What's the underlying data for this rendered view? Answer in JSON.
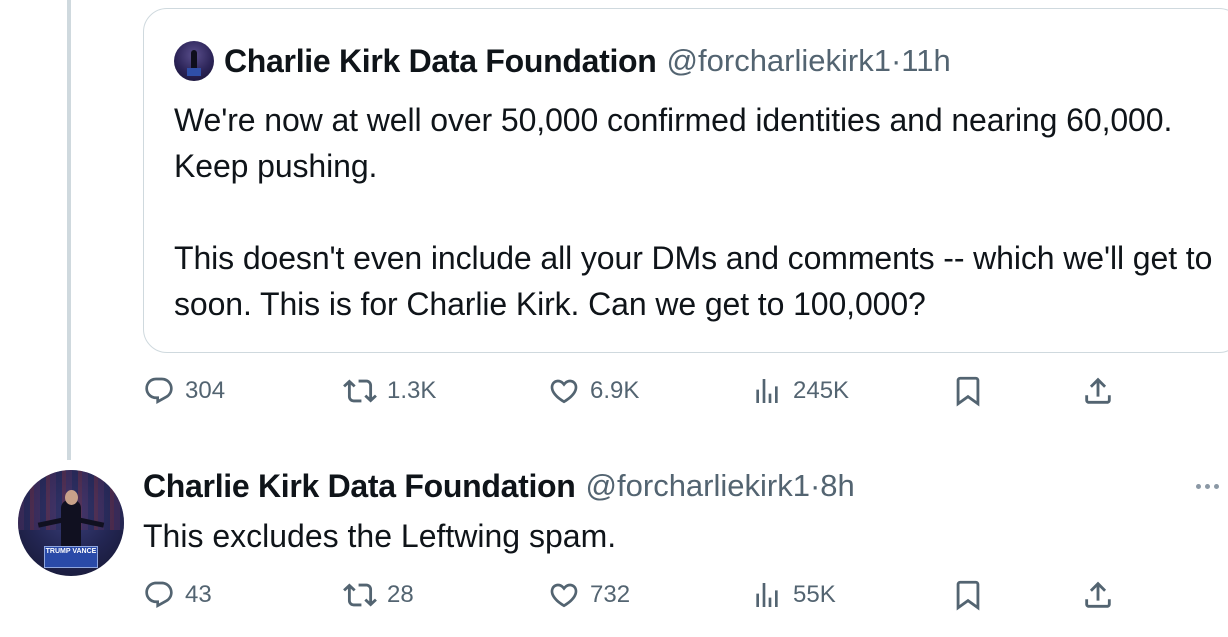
{
  "quote": {
    "author_name": "Charlie Kirk Data Foundation",
    "handle": "@forcharliekirk1",
    "separator": "·",
    "time": "11h",
    "text": "We're now at well over 50,000 confirmed identities and nearing 60,000. Keep pushing.\n\nThis doesn't even include all your DMs and comments -- which we'll get to soon. This is for Charlie Kirk. Can we get to 100,000?"
  },
  "quote_actions": {
    "replies": "304",
    "reposts": "1.3K",
    "likes": "6.9K",
    "views": "245K"
  },
  "reply": {
    "author_name": "Charlie Kirk Data Foundation",
    "handle": "@forcharliekirk1",
    "separator": "·",
    "time": "8h",
    "text": "This excludes the Leftwing spam.",
    "avatar_podium_text": "TRUMP VANCE"
  },
  "reply_actions": {
    "replies": "43",
    "reposts": "28",
    "likes": "732",
    "views": "55K"
  },
  "icons": [
    "reply-icon",
    "repost-icon",
    "like-icon",
    "views-icon",
    "bookmark-icon",
    "share-icon",
    "more-icon"
  ],
  "colors": {
    "text": "#0f1419",
    "secondary": "#536471",
    "border": "#cfd9de"
  }
}
